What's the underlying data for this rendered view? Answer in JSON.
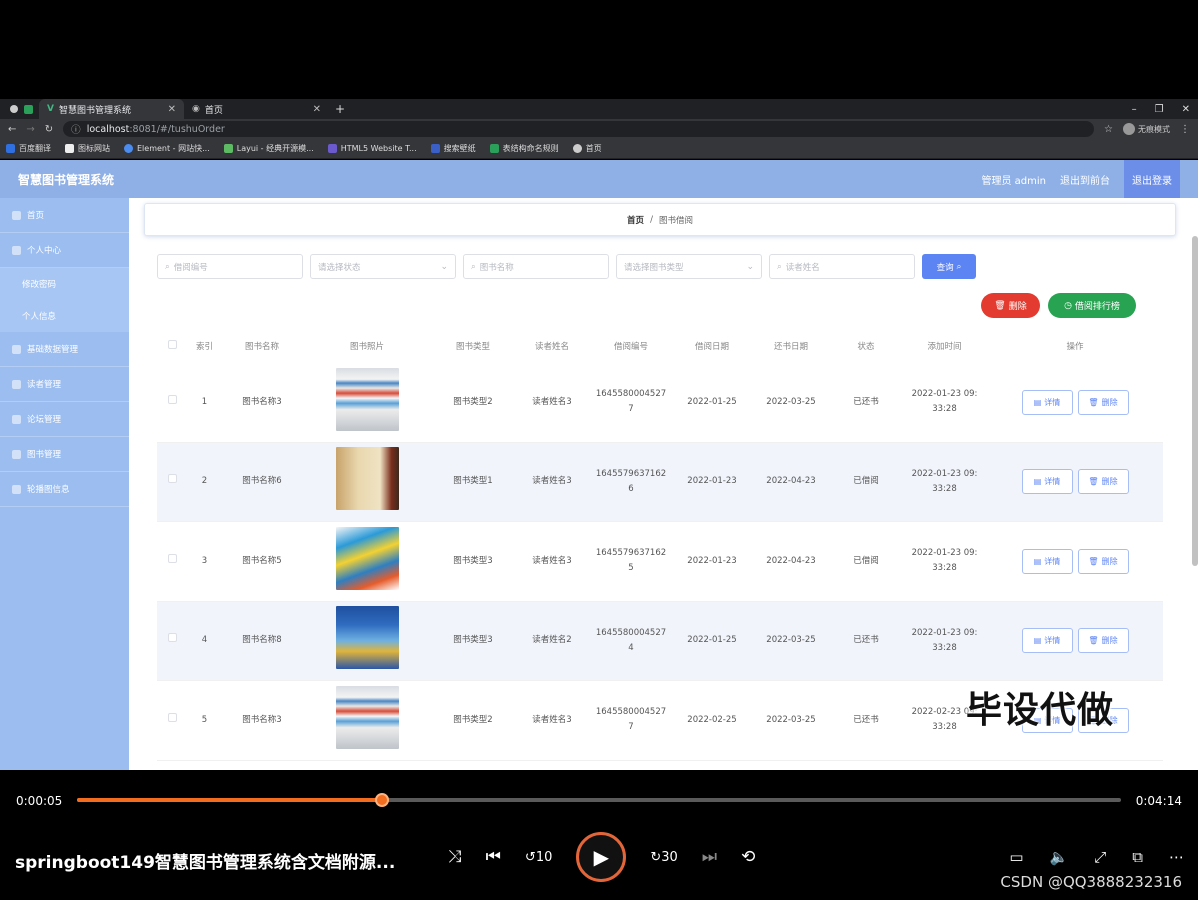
{
  "browser": {
    "tabs": [
      {
        "label": "智慧图书管理系统",
        "active": true
      },
      {
        "label": "首页",
        "active": false
      }
    ],
    "url_host": "localhost",
    "url_rest": ":8081/#/tushuOrder",
    "profile_label": "无痕模式",
    "bookmarks": [
      "百度翻译",
      "图标网站",
      "Element - 网站快...",
      "Layui - 经典开源模...",
      "HTML5 Website T...",
      "搜索壁纸",
      "表结构命名规则",
      "首页"
    ]
  },
  "header": {
    "brand": "智慧图书管理系统",
    "admin_label": "管理员 admin",
    "front_label": "退出到前台",
    "logout_label": "退出登录"
  },
  "sidebar": {
    "items": [
      {
        "label": "首页",
        "icon": "home-icon"
      },
      {
        "label": "个人中心",
        "icon": "user-icon",
        "children": [
          "修改密码",
          "个人信息"
        ]
      },
      {
        "label": "基础数据管理",
        "icon": "data-icon"
      },
      {
        "label": "读者管理",
        "icon": "reader-icon"
      },
      {
        "label": "论坛管理",
        "icon": "forum-icon"
      },
      {
        "label": "图书管理",
        "icon": "book-icon"
      },
      {
        "label": "轮播图信息",
        "icon": "carousel-icon"
      }
    ]
  },
  "breadcrumb": {
    "home": "首页",
    "sep": "/",
    "current": "图书借阅"
  },
  "filters": {
    "borrow_no": "借阅编号",
    "status": "请选择状态",
    "book_name": "图书名称",
    "book_type": "请选择图书类型",
    "reader_name": "读者姓名",
    "query_label": "查询"
  },
  "actions": {
    "delete_label": "删除",
    "rank_label": "借阅排行榜"
  },
  "table": {
    "columns": [
      "索引",
      "图书名称",
      "图书照片",
      "图书类型",
      "读者姓名",
      "借阅编号",
      "借阅日期",
      "还书日期",
      "状态",
      "添加时间",
      "操作"
    ],
    "detail_label": "详情",
    "delete_label": "删除",
    "rows": [
      {
        "idx": "1",
        "name": "图书名称3",
        "type": "图书类型2",
        "reader": "读者姓名3",
        "no1": "1645580004527",
        "no2": "7",
        "borrow": "2022-01-25",
        "ret": "2022-03-25",
        "status": "已还书",
        "time1": "2022-01-23 09:",
        "time2": "33:28",
        "thumb": "stack"
      },
      {
        "idx": "2",
        "name": "图书名称6",
        "type": "图书类型1",
        "reader": "读者姓名3",
        "no1": "1645579637162",
        "no2": "6",
        "borrow": "2022-01-23",
        "ret": "2022-04-23",
        "status": "已借阅",
        "time1": "2022-01-23 09:",
        "time2": "33:28",
        "thumb": "classic"
      },
      {
        "idx": "3",
        "name": "图书名称5",
        "type": "图书类型3",
        "reader": "读者姓名3",
        "no1": "1645579637162",
        "no2": "5",
        "borrow": "2022-01-23",
        "ret": "2022-04-23",
        "status": "已借阅",
        "time1": "2022-01-23 09:",
        "time2": "33:28",
        "thumb": "kids"
      },
      {
        "idx": "4",
        "name": "图书名称8",
        "type": "图书类型3",
        "reader": "读者姓名2",
        "no1": "1645580004527",
        "no2": "4",
        "borrow": "2022-01-25",
        "ret": "2022-03-25",
        "status": "已还书",
        "time1": "2022-01-23 09:",
        "time2": "33:28",
        "thumb": "blue"
      },
      {
        "idx": "5",
        "name": "图书名称3",
        "type": "图书类型2",
        "reader": "读者姓名3",
        "no1": "1645580004527",
        "no2": "7",
        "borrow": "2022-02-25",
        "ret": "2022-03-25",
        "status": "已还书",
        "time1": "2022-02-23 09:",
        "time2": "33:28",
        "thumb": "stack"
      }
    ]
  },
  "watermark": "毕设代做",
  "player": {
    "current_time": "0:00:05",
    "total_time": "0:04:14",
    "progress": 0.292,
    "title": "springboot149智慧图书管理系统含文档附源...",
    "credit": "CSDN @QQ3888232316",
    "accent": "#f26d1f"
  }
}
